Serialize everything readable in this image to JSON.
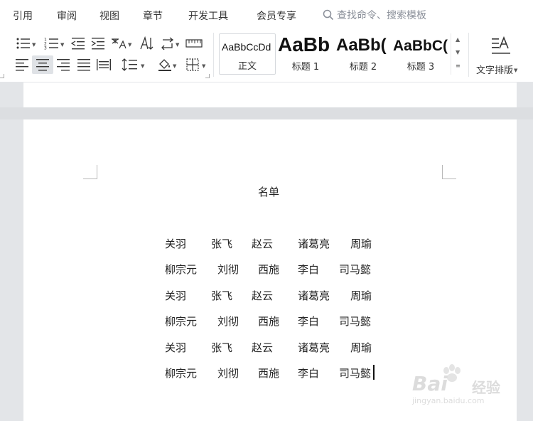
{
  "menu": {
    "items": [
      "引用",
      "审阅",
      "视图",
      "章节",
      "开发工具",
      "会员专享"
    ],
    "search_placeholder": "查找命令、搜索模板"
  },
  "ribbon": {
    "styles": [
      {
        "sample": "AaBbCcDd",
        "label": "正文"
      },
      {
        "sample": "AaBb",
        "label": "标题 1"
      },
      {
        "sample": "AaBb(",
        "label": "标题 2"
      },
      {
        "sample": "AaBbC(",
        "label": "标题 3"
      }
    ],
    "text_layout_label": "文字排版"
  },
  "document": {
    "title": "名单",
    "lines": [
      [
        "关羽",
        "张飞",
        "赵云",
        "诸葛亮",
        "周瑜"
      ],
      [
        "柳宗元",
        "刘彻",
        "西施",
        "李白",
        "司马懿"
      ],
      [
        "关羽",
        "张飞",
        "赵云",
        "诸葛亮",
        "周瑜"
      ],
      [
        "柳宗元",
        "刘彻",
        "西施",
        "李白",
        "司马懿"
      ],
      [
        "关羽",
        "张飞",
        "赵云",
        "诸葛亮",
        "周瑜"
      ],
      [
        "柳宗元",
        "刘彻",
        "西施",
        "李白",
        "司马懿"
      ]
    ]
  },
  "watermark": {
    "brand": "Bai",
    "brand_suffix": "经验",
    "url": "jingyan.baidu.com"
  },
  "colors": {
    "ribbon_bg": "#ffffff",
    "workspace_bg": "#e3e5e8",
    "active_tool": "#dfe2e6"
  }
}
